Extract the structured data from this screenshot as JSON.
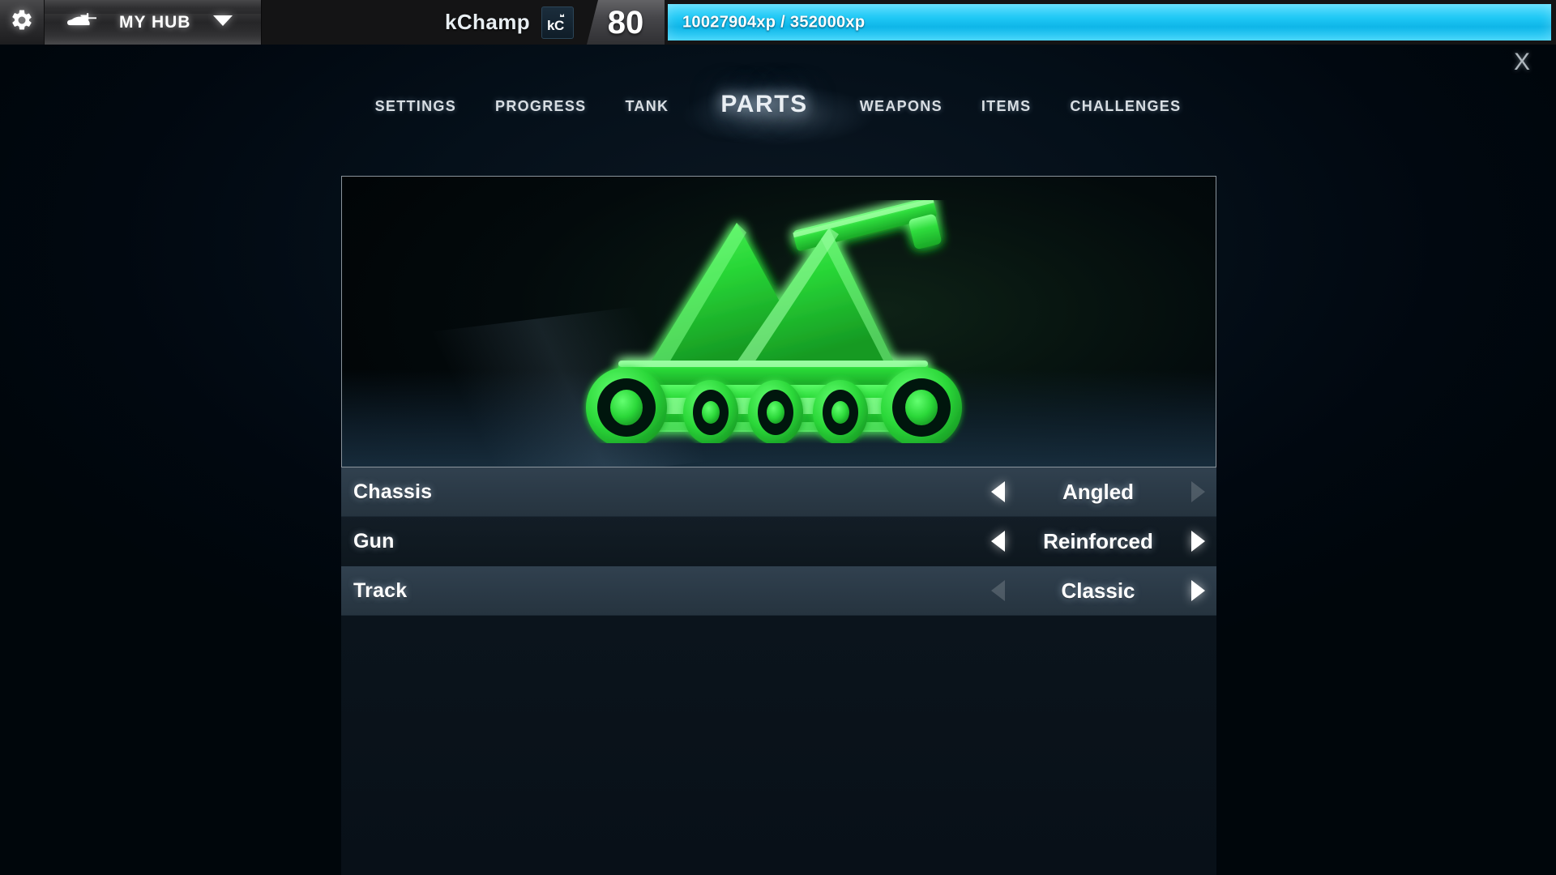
{
  "topbar": {
    "gear_icon": "gear-icon",
    "hub_tank_icon": "tank-icon",
    "hub_label": "MY HUB",
    "hub_caret_icon": "chevron-down-icon",
    "player_name": "kChamp",
    "badge_text": "kC",
    "badge_icon": "crown-icon",
    "level": "80",
    "xp_text": "10027904xp / 352000xp",
    "xp_current": 10027904,
    "xp_required": 352000,
    "xp_percent": 100,
    "xp_color": "#1fc8f5"
  },
  "close_button": {
    "label": "X",
    "icon": "close-icon"
  },
  "nav": {
    "tabs": [
      {
        "label": "SETTINGS",
        "active": false
      },
      {
        "label": "PROGRESS",
        "active": false
      },
      {
        "label": "TANK",
        "active": false
      },
      {
        "label": "PARTS",
        "active": true
      },
      {
        "label": "WEAPONS",
        "active": false
      },
      {
        "label": "ITEMS",
        "active": false
      },
      {
        "label": "CHALLENGES",
        "active": false
      }
    ],
    "active_tab": "PARTS"
  },
  "preview": {
    "alt": "tank-preview",
    "tank_color": "#2ee03c",
    "tank_glow_color": "#3dff4a",
    "background_color": "#03090c"
  },
  "parts": {
    "rows": [
      {
        "name": "Chassis",
        "value": "Angled",
        "style": "light",
        "prev_enabled": true,
        "next_enabled": false
      },
      {
        "name": "Gun",
        "value": "Reinforced",
        "style": "dark",
        "prev_enabled": true,
        "next_enabled": true
      },
      {
        "name": "Track",
        "value": "Classic",
        "style": "light",
        "prev_enabled": false,
        "next_enabled": true
      }
    ],
    "prev_icon": "chevron-left-icon",
    "next_icon": "chevron-right-icon"
  }
}
